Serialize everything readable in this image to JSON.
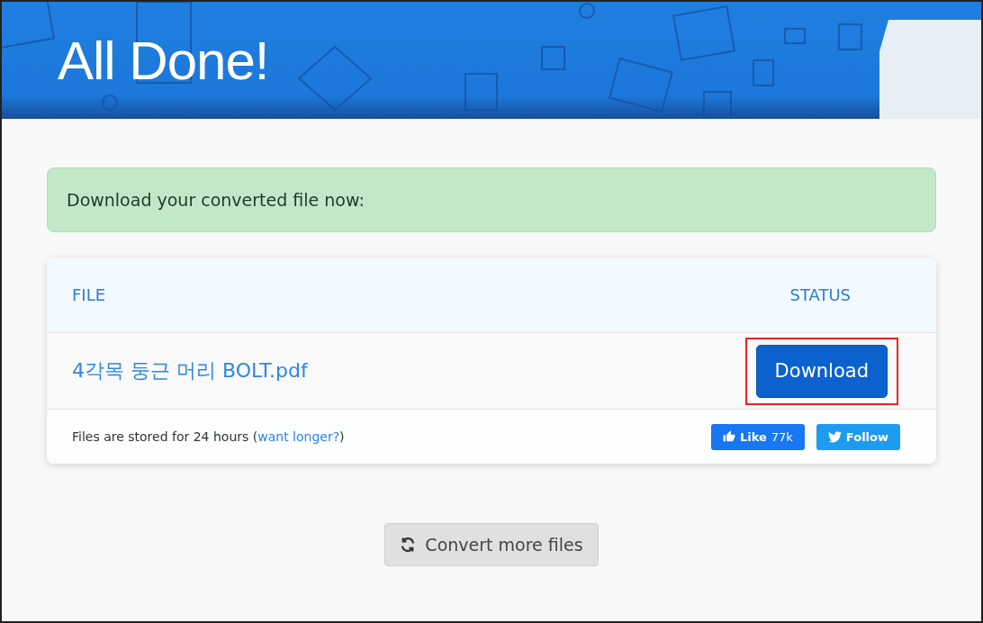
{
  "banner": {
    "title": "All Done!"
  },
  "notice": {
    "text": "Download your converted file now:"
  },
  "table": {
    "columns": [
      "FILE",
      "STATUS"
    ],
    "rows": [
      {
        "file": "4각목 둥근 머리 BOLT.pdf",
        "action": "Download",
        "highlighted": true
      }
    ]
  },
  "footer": {
    "text": "Files are stored for 24 hours (",
    "link": "want longer?",
    "text_end": ")",
    "like": {
      "label": "Like",
      "count": "77k"
    },
    "follow": "Follow"
  },
  "convert_button": "Convert more files"
}
